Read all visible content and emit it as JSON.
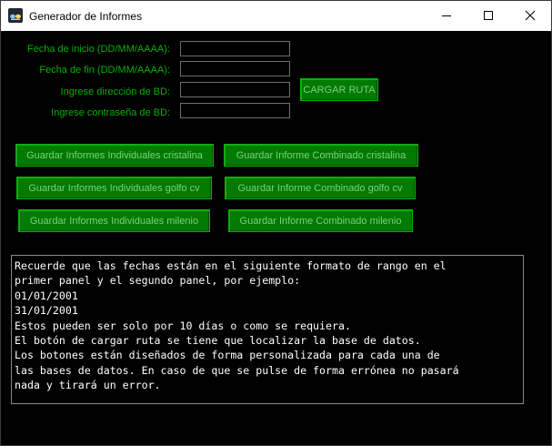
{
  "window": {
    "title": "Generador de Informes"
  },
  "form": {
    "start_date_label": "Fecha de inicio (DD/MM/AAAA):",
    "start_date_value": "",
    "end_date_label": "Fecha de fin (DD/MM/AAAA):",
    "end_date_value": "",
    "db_path_label": "Ingrese dirección de BD:",
    "db_path_value": "",
    "db_password_label": "Ingrese contraseña de BD:",
    "db_password_value": "",
    "load_path_button": "CARGAR RUTA"
  },
  "report_buttons": {
    "individual_cristalina": "Guardar Informes Individuales cristalina",
    "combined_cristalina": "Guardar Informe Combinado cristalina",
    "individual_golfo": "Guardar Informes Individuales golfo cv",
    "combined_golfo": "Guardar Informe Combinado golfo cv",
    "individual_milenio": "Guardar Informes Individuales milenio",
    "combined_milenio": "Guardar Informe Combinado milenio"
  },
  "info_text": {
    "lines": [
      "Recuerde que las fechas están en el siguiente formato de rango en el",
      "primer panel y el segundo panel, por ejemplo:",
      "01/01/2001",
      "31/01/2001",
      "Estos pueden ser solo por 10 días o como se requiera.",
      "El botón de cargar ruta se tiene que localizar la base de datos.",
      "Los botones están diseñados de forma personalizada para cada una de",
      "las bases de datos. En caso de que se pulse de forma errónea no pasará",
      "nada y tirará un error."
    ]
  },
  "colors": {
    "background": "#000000",
    "label_green": "#00b000",
    "button_green": "#007a00",
    "button_text": "#7fd07f",
    "titlebar": "#ffffff"
  },
  "icons": {
    "app": "app-icon",
    "minimize": "minimize-icon",
    "maximize": "maximize-icon",
    "close": "close-icon"
  }
}
